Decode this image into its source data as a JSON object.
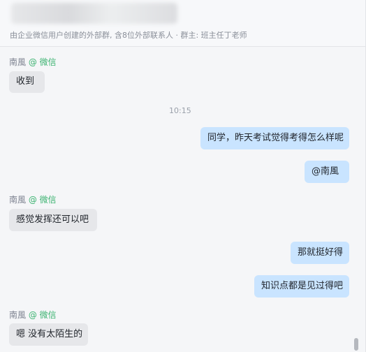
{
  "header": {
    "subtitle": "由企业微信用户创建的外部群, 含8位外部联系人 · 群主: 班主任丁老师"
  },
  "messages": [
    {
      "sender": "南風",
      "tag": "@ 微信",
      "text": "收到"
    },
    {
      "timestamp": "10:15"
    },
    {
      "text": "同学，昨天考试觉得考得怎么样呢"
    },
    {
      "text": "@南風"
    },
    {
      "sender": "南風",
      "tag": "@ 微信",
      "text": "感觉发挥还可以吧"
    },
    {
      "text": "那就挺好得"
    },
    {
      "text": "知识点都是见过得吧"
    },
    {
      "sender": "南風",
      "tag": "@ 微信",
      "text": "嗯 没有太陌生的"
    }
  ],
  "colors": {
    "incoming_bubble": "#e6e7ea",
    "outgoing_bubble": "#c9e4ff",
    "wechat_tag": "#3cb371"
  }
}
